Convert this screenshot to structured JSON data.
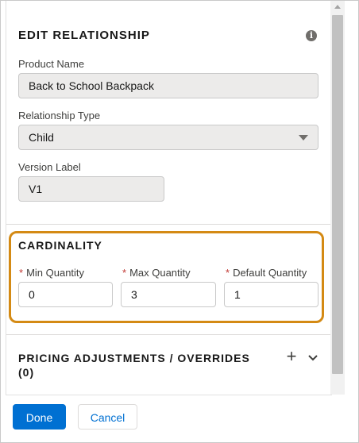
{
  "edit_section": {
    "title": "EDIT RELATIONSHIP",
    "info_icon_glyph": "i",
    "product_name": {
      "label": "Product Name",
      "value": "Back to School Backpack"
    },
    "relationship_type": {
      "label": "Relationship Type",
      "selected": "Child"
    },
    "version_label": {
      "label": "Version Label",
      "value": "V1"
    }
  },
  "cardinality": {
    "title": "CARDINALITY",
    "required_marker": "*",
    "min_quantity": {
      "label": "Min Quantity",
      "value": "0"
    },
    "max_quantity": {
      "label": "Max Quantity",
      "value": "3"
    },
    "default_quantity": {
      "label": "Default Quantity",
      "value": "1"
    },
    "highlight_color": "#d48a14"
  },
  "pricing": {
    "title_line1": "PRICING ADJUSTMENTS / OVERRIDES",
    "title_line2": "(0)",
    "add_glyph": "+",
    "expand_glyph": "⌄"
  },
  "footer": {
    "done_label": "Done",
    "cancel_label": "Cancel"
  },
  "colors": {
    "brand": "#0070d2",
    "readonly_bg": "#ecebea",
    "required": "#c23934"
  }
}
